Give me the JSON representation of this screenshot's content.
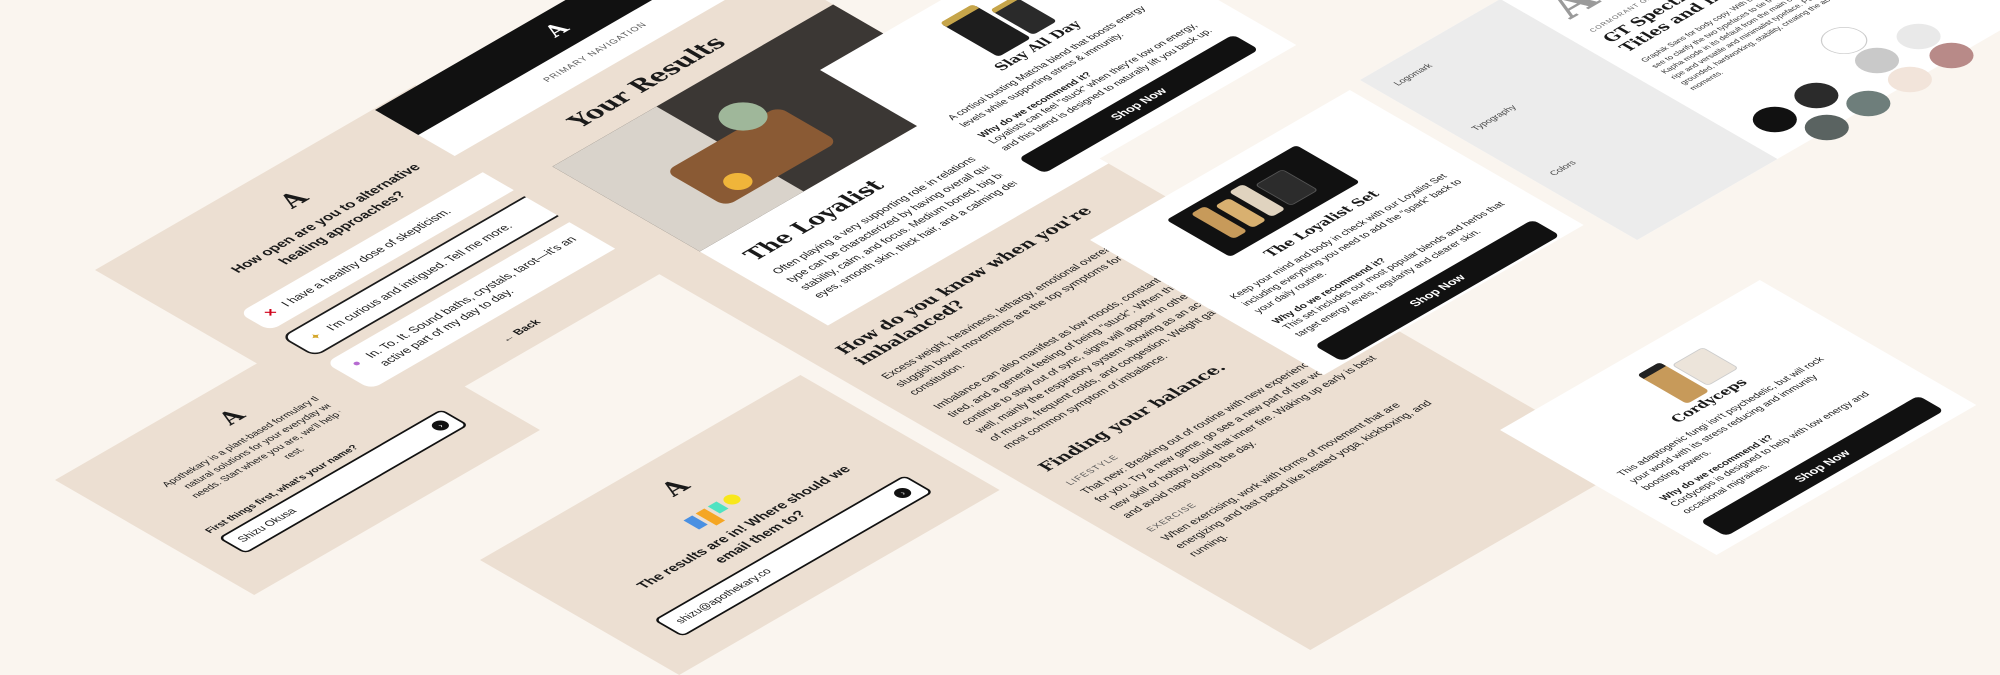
{
  "quiz": {
    "logo": "A",
    "question": "How open are you to alternative healing approaches?",
    "options": [
      {
        "icon": "✕",
        "text": "I have a healthy dose of skepticism."
      },
      {
        "icon": "✦",
        "text": "I'm curious and intrigued. Tell me more."
      },
      {
        "icon": "●",
        "text": "In. To. It. Sound baths, crystals, tarot—it's an active part of my day to day."
      }
    ],
    "back": "← Back"
  },
  "intro": {
    "logo": "A",
    "text": "Apothekary is a plant-based formulary that offers natural solutions for your everyday wellness needs. Start where you are, we'll help with the rest.",
    "label": "First things first, what's your name?",
    "name_value": "Shizu Okusa"
  },
  "results": {
    "nav_label": "PRIMARY NAVIGATION",
    "logo": "A",
    "title": "Your Results",
    "type_title": "The Loyalist",
    "type_desc": "Often playing a very supporting role in relationships, this type can be characterized by having overall qualities of stability, calm, and focus. Medium boned, big beautiful eyes, smooth skin, thick hair, and a calming demeanor.",
    "imbalance_title": "How do you know when you're imbalanced?",
    "imbalance_p1": "Excess weight, heaviness, lethargy, emotional overeating, and sluggish bowel movements are the top symptoms for your constitution.",
    "imbalance_p2": "Imbalance can also manifest as low moods, constantly feeling tired, and a general feeling of being \"stuck\". When things continue to stay out of sync, signs will appear in other places as well, mainly the respiratory system showing as an accumulation of mucus, frequent colds, and congestion. Weight gain is the most common symptom of imbalance.",
    "balance_title": "Finding your balance.",
    "lifestyle_label": "LIFESTYLE",
    "lifestyle_text": "That new: Breaking out of routine with new experiences is ideal for you. Try a new game, go see a new part of the world, learn a new skill or hobby. Build that inner fire. Waking up early is best and avoid naps during the day.",
    "exercise_label": "EXERCISE",
    "exercise_text": "When exercising, work with forms of movement that are energizing and fast paced like heated yoga, kickboxing, and running."
  },
  "email": {
    "logo": "A",
    "title": "The results are in! Where should we email them to?",
    "email_value": "shizu@apothekary.co"
  },
  "product1": {
    "name": "Slay All Day",
    "desc": "A cortisol busting Matcha blend that boosts energy levels while supporting stress & immunity.",
    "why_title": "Why do we recommend it?",
    "why_text": "Loyalists can feel \"stuck\" when they're low on energy, and this blend is designed to naturally lift you back up.",
    "cta": "Shop Now"
  },
  "product2": {
    "name": "The Loyalist Set",
    "desc": "Keep your mind and body in check with our Loyalist Set including everything you need to add the \"spark\" back to your daily routine.",
    "why_title": "Why do we recommend it?",
    "why_text": "This set includes our most popular blends and herbs that target energy levels, regularity and clearer skin.",
    "cta": "Shop Now"
  },
  "product3": {
    "name": "Cordyceps",
    "desc": "This adaptogenic fungi isn't psychedelic, but will rock your world with its stress reducing and immunity boosting powers.",
    "why_title": "Why do we recommend it?",
    "why_text": "Cordyceps is designed to help with low energy and occasional migraines.",
    "cta": "Shop Now"
  },
  "styleguide": {
    "nav": [
      "Logomark",
      "Typography",
      "Colors"
    ],
    "type_caption": "CORMORANT GARAMOND SANS TYPEFACE",
    "heading": "GT Spectra Fine Bold — Titles and headlines",
    "body": "Graphik Sans for body copy. With the AG Studio, you would see to clarify the two typefaces to tie the system together. Kapha mode in its default from the main content shown as the ripe and versatile and minimalist typeface. Pulse Kapha is grounded, hardworking, stability, creating the ability to have moments.",
    "swatches": [
      "#ffffff",
      "#111111",
      "#2b2b2b",
      "#c9c9c9",
      "#6e7e7b",
      "#e9e9e9",
      "#5a6361",
      "#f2e4da",
      "#b88a88"
    ]
  }
}
